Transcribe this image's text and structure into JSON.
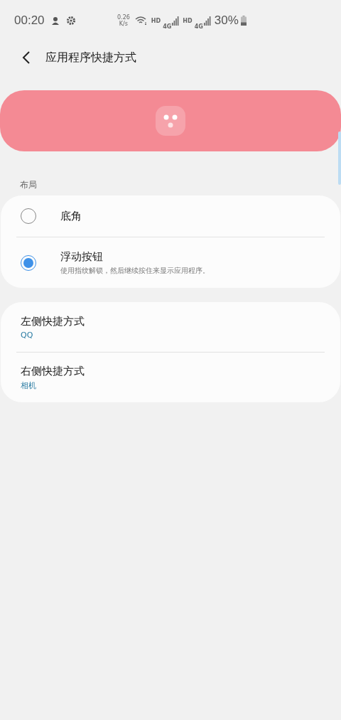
{
  "status_bar": {
    "time": "00:20",
    "net_speed": "0.26",
    "net_unit": "K/s",
    "hd_1": "HD",
    "network_1": "4G",
    "hd_2": "HD",
    "network_2": "4G",
    "battery": "30%"
  },
  "header": {
    "title": "应用程序快捷方式"
  },
  "layout_section": {
    "label": "布局",
    "options": [
      {
        "label": "底角",
        "selected": false
      },
      {
        "label": "浮动按钮",
        "selected": true,
        "description": "使用指纹解锁，然后继续按住来显示应用程序。"
      }
    ]
  },
  "shortcuts": [
    {
      "title": "左侧快捷方式",
      "value": "QQ"
    },
    {
      "title": "右侧快捷方式",
      "value": "相机"
    }
  ]
}
